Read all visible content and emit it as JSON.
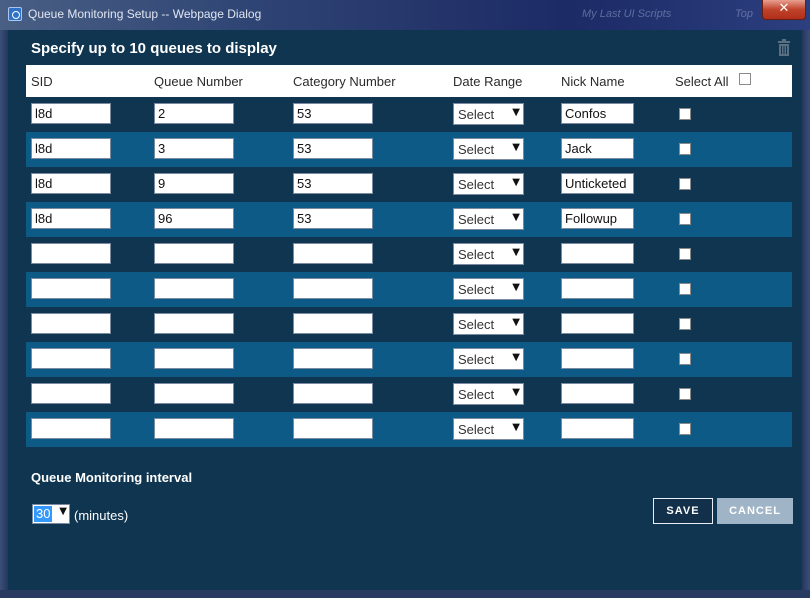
{
  "window": {
    "title": "Queue Monitoring Setup -- Webpage Dialog",
    "close_label": "✕",
    "background_text": [
      "My Last UI Scripts",
      "Top"
    ]
  },
  "dialog": {
    "heading": "Specify up to 10 queues to display",
    "trash_icon": "trash-icon"
  },
  "table": {
    "headers": {
      "sid": "SID",
      "queue_number": "Queue Number",
      "category_number": "Category Number",
      "date_range": "Date Range",
      "nick_name": "Nick Name",
      "select_all": "Select All"
    },
    "rows": [
      {
        "sid": "l8d",
        "queue": "2",
        "category": "53",
        "date_range": "Select",
        "nick": "Confos",
        "checked": false
      },
      {
        "sid": "l8d",
        "queue": "3",
        "category": "53",
        "date_range": "Select",
        "nick": "Jack",
        "checked": false
      },
      {
        "sid": "l8d",
        "queue": "9",
        "category": "53",
        "date_range": "Select",
        "nick": "Unticketed",
        "checked": false
      },
      {
        "sid": "l8d",
        "queue": "96",
        "category": "53",
        "date_range": "Select",
        "nick": "Followup",
        "checked": false
      },
      {
        "sid": "",
        "queue": "",
        "category": "",
        "date_range": "Select",
        "nick": "",
        "checked": false
      },
      {
        "sid": "",
        "queue": "",
        "category": "",
        "date_range": "Select",
        "nick": "",
        "checked": false
      },
      {
        "sid": "",
        "queue": "",
        "category": "",
        "date_range": "Select",
        "nick": "",
        "checked": false
      },
      {
        "sid": "",
        "queue": "",
        "category": "",
        "date_range": "Select",
        "nick": "",
        "checked": false
      },
      {
        "sid": "",
        "queue": "",
        "category": "",
        "date_range": "Select",
        "nick": "",
        "checked": false
      },
      {
        "sid": "",
        "queue": "",
        "category": "",
        "date_range": "Select",
        "nick": "",
        "checked": false
      }
    ]
  },
  "interval": {
    "label": "Queue Monitoring interval",
    "value": "30",
    "unit": "(minutes)"
  },
  "buttons": {
    "save": "SAVE",
    "cancel": "CANCEL"
  },
  "colors": {
    "panel": "#0f3550",
    "row_alt": "#0c5a85",
    "header_bg": "#ffffff",
    "selection": "#3399ff"
  }
}
